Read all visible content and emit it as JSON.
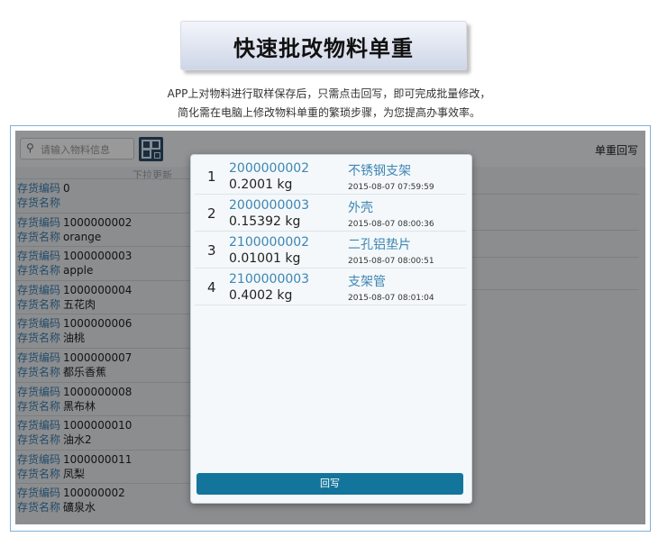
{
  "banner": {
    "title": "快速批改物料单重"
  },
  "intro": {
    "line1": "APP上对物料进行取样保存后，只需点击回写，即可完成批量修改，",
    "line2": "简化需在电脑上修改物料单重的繁琐步骤，为您提高办事效率。"
  },
  "app": {
    "search_placeholder": "请输入物料信息",
    "search_icon": "search-icon",
    "qr_icon": "qr-code-icon",
    "weight_writeback_label": "单重回写",
    "pull_refresh": "下拉更新",
    "code_label": "存货编码",
    "name_label": "存货名称",
    "items": [
      {
        "code": "0",
        "name": ""
      },
      {
        "code": "1000000002",
        "name": "orange"
      },
      {
        "code": "1000000003",
        "name": "apple"
      },
      {
        "code": "1000000004",
        "name": "五花肉"
      },
      {
        "code": "1000000006",
        "name": "油桃"
      },
      {
        "code": "1000000007",
        "name": "都乐香蕉"
      },
      {
        "code": "1000000008",
        "name": "黑布林"
      },
      {
        "code": "1000000010",
        "name": "油水2"
      },
      {
        "code": "1000000011",
        "name": "凤梨"
      },
      {
        "code": "100000002",
        "name": "礦泉水"
      }
    ]
  },
  "modal": {
    "rows": [
      {
        "index": "1",
        "code": "2000000002",
        "weight": "0.2001 kg",
        "name": "不锈钢支架",
        "time": "2015-08-07 07:59:59"
      },
      {
        "index": "2",
        "code": "2000000003",
        "weight": "0.15392 kg",
        "name": "外壳",
        "time": "2015-08-07 08:00:36"
      },
      {
        "index": "3",
        "code": "2100000002",
        "weight": "0.01001 kg",
        "name": "二孔铝垫片",
        "time": "2015-08-07 08:00:51"
      },
      {
        "index": "4",
        "code": "2100000003",
        "weight": "0.4002 kg",
        "name": "支架管",
        "time": "2015-08-07 08:01:04"
      }
    ],
    "writeback_button": "回写"
  },
  "colors": {
    "accent": "#3e86b4",
    "button": "#14759c",
    "frame_border": "#7fb0d8"
  }
}
